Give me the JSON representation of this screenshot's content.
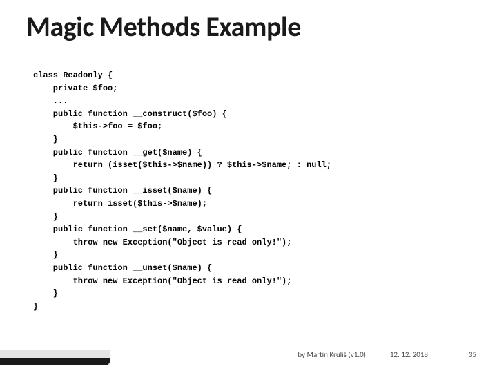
{
  "title": "Magic Methods Example",
  "code": {
    "l01": "class Readonly {",
    "l02": "    private $foo;",
    "l03": "    ...",
    "l04": "    public function __construct($foo) {",
    "l05": "        $this->foo = $foo;",
    "l06": "    }",
    "l07": "    public function __get($name) {",
    "l08": "        return (isset($this->$name)) ? $this->$name; : null;",
    "l09": "    }",
    "l10": "    public function __isset($name) {",
    "l11": "        return isset($this->$name);",
    "l12": "    }",
    "l13": "    public function __set($name, $value) {",
    "l14": "        throw new Exception(\"Object is read only!\");",
    "l15": "    }",
    "l16": "    public function __unset($name) {",
    "l17": "        throw new Exception(\"Object is read only!\");",
    "l18": "    }",
    "l19": "}"
  },
  "footer": {
    "author": "by Martin Kruliš (v1.0)",
    "date": "12. 12. 2018",
    "page": "35"
  }
}
